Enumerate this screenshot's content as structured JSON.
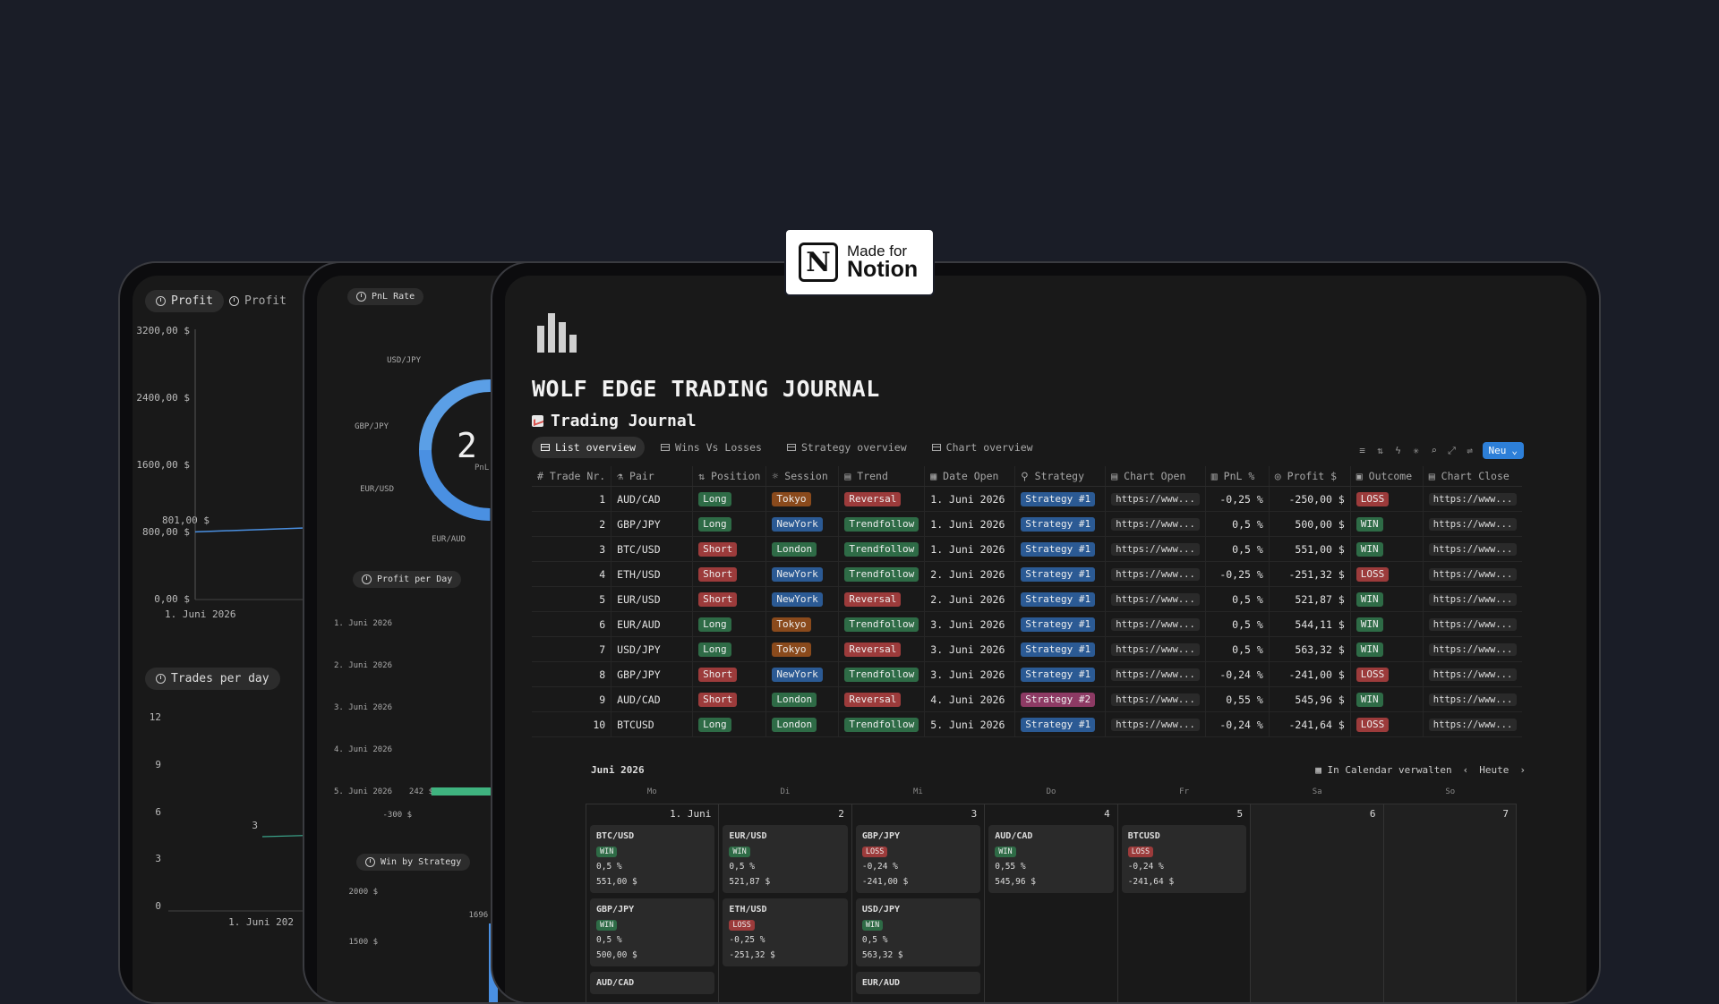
{
  "badge": {
    "line1": "Made for",
    "line2": "Notion",
    "logo_letter": "N"
  },
  "left_panel": {
    "pill_profit": "Profit",
    "pill_profit2": "Profit",
    "y_labels": [
      "3200,00 $",
      "2400,00 $",
      "1600,00 $",
      "800,00 $",
      "0,00 $"
    ],
    "point_label": "801,00 $",
    "x_label": "1. Juni 2026",
    "pill_trades": "Trades per day",
    "trades_y": [
      "12",
      "9",
      "6",
      "3",
      "0"
    ],
    "trades_point": "3",
    "trades_x": "1. Juni 202",
    "chart_data": {
      "type": "line",
      "title": "Profit",
      "x": [
        "1. Juni 2026"
      ],
      "series": [
        {
          "values": [
            801.0
          ]
        }
      ],
      "ylim": [
        0,
        3200
      ]
    }
  },
  "mid_panel": {
    "pill_pnl": "PnL Rate",
    "donut_value": "2 %",
    "donut_sub": "PnL",
    "donut_labels": [
      "USD/JPY",
      "GBP/JPY",
      "EUR/USD",
      "EUR/AUD"
    ],
    "pill_profit_day": "Profit per Day",
    "day_labels": [
      "1. Juni 2026",
      "2. Juni 2026",
      "3. Juni 2026",
      "4. Juni 2026",
      "5. Juni 2026"
    ],
    "day_value_label": "242 $",
    "axis_value": "-300 $",
    "pill_strategy": "Win by Strategy",
    "strategy_y": [
      "2000 $",
      "1500 $"
    ],
    "strategy_value": "1696 $"
  },
  "main": {
    "title": "WOLF EDGE TRADING JOURNAL",
    "subtitle": "Trading Journal",
    "tabs": [
      "List overview",
      "Wins Vs Losses",
      "Strategy overview",
      "Chart overview"
    ],
    "new_button": "Neu",
    "columns": [
      "Trade Nr.",
      "Pair",
      "Position",
      "Session",
      "Trend",
      "Date Open",
      "Strategy",
      "Chart Open",
      "PnL %",
      "Profit $",
      "Outcome",
      "Chart Close"
    ],
    "colors": {
      "long": "#2e6b46",
      "short": "#9c3b3b",
      "tokyo": "#8a4a1c",
      "newyork": "#2b5a94",
      "london": "#2e6b46",
      "reversal": "#9c3b3b",
      "trendfollow": "#2e6b46",
      "strategy1": "#2b5a94",
      "strategy2": "#8d3a64",
      "win": "#2e6b46",
      "loss": "#9c3b3b"
    },
    "rows": [
      {
        "nr": "1",
        "pair": "AUD/CAD",
        "position": "Long",
        "session": "Tokyo",
        "trend": "Reversal",
        "date": "1. Juni 2026",
        "strategy": "Strategy #1",
        "chart_open": "https://www...",
        "pnl": "-0,25 %",
        "profit": "-250,00 $",
        "outcome": "LOSS",
        "chart_close": "https://www..."
      },
      {
        "nr": "2",
        "pair": "GBP/JPY",
        "position": "Long",
        "session": "NewYork",
        "trend": "Trendfollow",
        "date": "1. Juni 2026",
        "strategy": "Strategy #1",
        "chart_open": "https://www...",
        "pnl": "0,5 %",
        "profit": "500,00 $",
        "outcome": "WIN",
        "chart_close": "https://www..."
      },
      {
        "nr": "3",
        "pair": "BTC/USD",
        "position": "Short",
        "session": "London",
        "trend": "Trendfollow",
        "date": "1. Juni 2026",
        "strategy": "Strategy #1",
        "chart_open": "https://www...",
        "pnl": "0,5 %",
        "profit": "551,00 $",
        "outcome": "WIN",
        "chart_close": "https://www..."
      },
      {
        "nr": "4",
        "pair": "ETH/USD",
        "position": "Short",
        "session": "NewYork",
        "trend": "Trendfollow",
        "date": "2. Juni 2026",
        "strategy": "Strategy #1",
        "chart_open": "https://www...",
        "pnl": "-0,25 %",
        "profit": "-251,32 $",
        "outcome": "LOSS",
        "chart_close": "https://www..."
      },
      {
        "nr": "5",
        "pair": "EUR/USD",
        "position": "Short",
        "session": "NewYork",
        "trend": "Reversal",
        "date": "2. Juni 2026",
        "strategy": "Strategy #1",
        "chart_open": "https://www...",
        "pnl": "0,5 %",
        "profit": "521,87 $",
        "outcome": "WIN",
        "chart_close": "https://www..."
      },
      {
        "nr": "6",
        "pair": "EUR/AUD",
        "position": "Long",
        "session": "Tokyo",
        "trend": "Trendfollow",
        "date": "3. Juni 2026",
        "strategy": "Strategy #1",
        "chart_open": "https://www...",
        "pnl": "0,5 %",
        "profit": "544,11 $",
        "outcome": "WIN",
        "chart_close": "https://www..."
      },
      {
        "nr": "7",
        "pair": "USD/JPY",
        "position": "Long",
        "session": "Tokyo",
        "trend": "Reversal",
        "date": "3. Juni 2026",
        "strategy": "Strategy #1",
        "chart_open": "https://www...",
        "pnl": "0,5 %",
        "profit": "563,32 $",
        "outcome": "WIN",
        "chart_close": "https://www..."
      },
      {
        "nr": "8",
        "pair": "GBP/JPY",
        "position": "Short",
        "session": "NewYork",
        "trend": "Trendfollow",
        "date": "3. Juni 2026",
        "strategy": "Strategy #1",
        "chart_open": "https://www...",
        "pnl": "-0,24 %",
        "profit": "-241,00 $",
        "outcome": "LOSS",
        "chart_close": "https://www..."
      },
      {
        "nr": "9",
        "pair": "AUD/CAD",
        "position": "Short",
        "session": "London",
        "trend": "Reversal",
        "date": "4. Juni 2026",
        "strategy": "Strategy #2",
        "chart_open": "https://www...",
        "pnl": "0,55 %",
        "profit": "545,96 $",
        "outcome": "WIN",
        "chart_close": "https://www..."
      },
      {
        "nr": "10",
        "pair": "BTCUSD",
        "position": "Long",
        "session": "London",
        "trend": "Trendfollow",
        "date": "5. Juni 2026",
        "strategy": "Strategy #1",
        "chart_open": "https://www...",
        "pnl": "-0,24 %",
        "profit": "-241,64 $",
        "outcome": "LOSS",
        "chart_close": "https://www..."
      }
    ],
    "calendar": {
      "month": "Juni 2026",
      "manage": "In Calendar verwalten",
      "today": "Heute",
      "weekdays": [
        "Mo",
        "Di",
        "Mi",
        "Do",
        "Fr",
        "Sa",
        "So"
      ],
      "days": [
        {
          "date": "1. Juni",
          "cards": [
            {
              "pair": "BTC/USD",
              "outcome": "WIN",
              "pnl": "0,5 %",
              "profit": "551,00 $"
            },
            {
              "pair": "GBP/JPY",
              "outcome": "WIN",
              "pnl": "0,5 %",
              "profit": "500,00 $"
            },
            {
              "pair": "AUD/CAD"
            }
          ]
        },
        {
          "date": "2",
          "cards": [
            {
              "pair": "EUR/USD",
              "outcome": "WIN",
              "pnl": "0,5 %",
              "profit": "521,87 $"
            },
            {
              "pair": "ETH/USD",
              "outcome": "LOSS",
              "pnl": "-0,25 %",
              "profit": "-251,32 $"
            }
          ]
        },
        {
          "date": "3",
          "cards": [
            {
              "pair": "GBP/JPY",
              "outcome": "LOSS",
              "pnl": "-0,24 %",
              "profit": "-241,00 $"
            },
            {
              "pair": "USD/JPY",
              "outcome": "WIN",
              "pnl": "0,5 %",
              "profit": "563,32 $"
            },
            {
              "pair": "EUR/AUD"
            }
          ]
        },
        {
          "date": "4",
          "cards": [
            {
              "pair": "AUD/CAD",
              "outcome": "WIN",
              "pnl": "0,55 %",
              "profit": "545,96 $"
            }
          ]
        },
        {
          "date": "5",
          "cards": [
            {
              "pair": "BTCUSD",
              "outcome": "LOSS",
              "pnl": "-0,24 %",
              "profit": "-241,64 $"
            }
          ]
        },
        {
          "date": "6",
          "cards": []
        },
        {
          "date": "7",
          "cards": []
        }
      ]
    }
  }
}
